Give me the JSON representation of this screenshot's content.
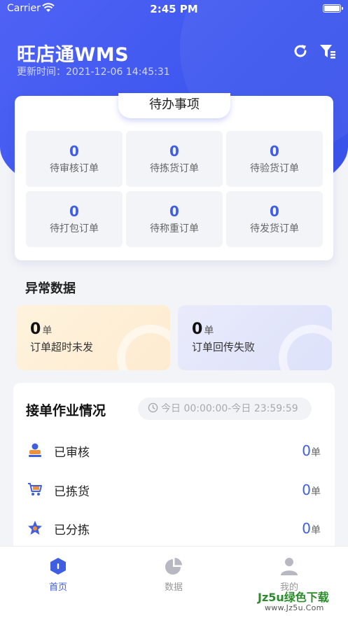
{
  "status_bar": {
    "carrier": "Carrier",
    "time": "2:45 PM"
  },
  "header": {
    "title": "旺店通WMS",
    "update_label": "更新时间：",
    "update_time": "2021-12-06 14:45:31",
    "icons": [
      "refresh-icon",
      "filter-icon"
    ]
  },
  "todo": {
    "title": "待办事项",
    "items": [
      {
        "value": "0",
        "label": "待审核订单"
      },
      {
        "value": "0",
        "label": "待拣货订单"
      },
      {
        "value": "0",
        "label": "待验货订单"
      },
      {
        "value": "0",
        "label": "待打包订单"
      },
      {
        "value": "0",
        "label": "待称重订单"
      },
      {
        "value": "0",
        "label": "待发货订单"
      }
    ]
  },
  "abnormal": {
    "title": "异常数据",
    "items": [
      {
        "value": "0",
        "unit": "单",
        "label": "订单超时未发"
      },
      {
        "value": "0",
        "unit": "单",
        "label": "订单回传失败"
      }
    ]
  },
  "operations": {
    "title": "接单作业情况",
    "range": "今日 00:00:00-今日 23:59:59",
    "rows": [
      {
        "label": "已审核",
        "value": "0",
        "unit": "单",
        "icon": "audit-stamp-icon"
      },
      {
        "label": "已拣货",
        "value": "0",
        "unit": "单",
        "icon": "cart-icon"
      },
      {
        "label": "已分拣",
        "value": "0",
        "unit": "单",
        "icon": "star-sort-icon"
      }
    ]
  },
  "tabbar": {
    "items": [
      {
        "label": "首页",
        "icon": "home-icon",
        "active": true
      },
      {
        "label": "数据",
        "icon": "pie-chart-icon",
        "active": false
      },
      {
        "label": "我的",
        "icon": "user-icon",
        "active": false
      }
    ]
  },
  "watermark": {
    "main": "Jz5u绿色下载",
    "sub": "www.Jz5u.Com"
  },
  "colors": {
    "primary": "#3f5fe0",
    "hero": "#4f62f5",
    "abnormal_warm": "#fff3dd",
    "abnormal_cool": "#e9ebfb"
  }
}
